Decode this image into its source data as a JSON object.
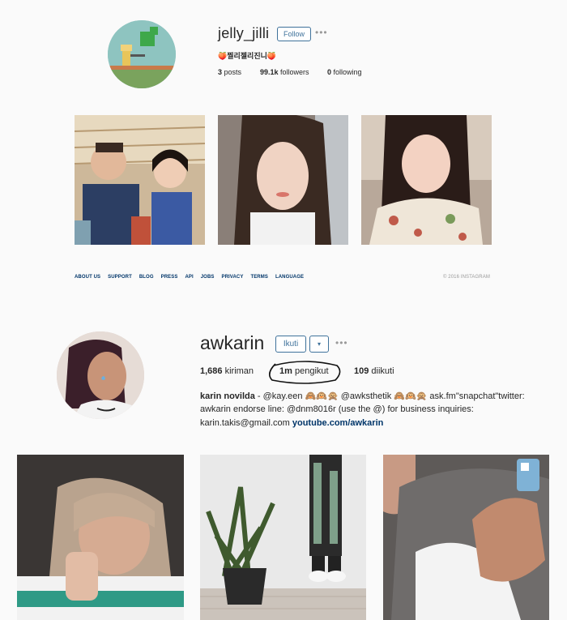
{
  "profile1": {
    "username": "jelly_jilli",
    "follow_label": "Follow",
    "more_label": "•••",
    "full_name": "🍑찔리젤리진니🍑",
    "stats": [
      {
        "value": "3",
        "label": "posts"
      },
      {
        "value": "99.1k",
        "label": "followers"
      },
      {
        "value": "0",
        "label": "following"
      }
    ],
    "footer_links": [
      "ABOUT US",
      "SUPPORT",
      "BLOG",
      "PRESS",
      "API",
      "JOBS",
      "PRIVACY",
      "TERMS",
      "LANGUAGE"
    ],
    "copyright": "© 2016 INSTAGRAM"
  },
  "profile2": {
    "username": "awkarin",
    "follow_label": "Ikuti",
    "dropdown_label": "▾",
    "more_label": "•••",
    "stats": [
      {
        "value": "1,686",
        "label": "kiriman"
      },
      {
        "value": "1m",
        "label": "pengikut"
      },
      {
        "value": "109",
        "label": "diikuti"
      }
    ],
    "bio_name": "karin novilda",
    "bio_line1_rest": " - @kay.een 🙈🙉🙊 @awksthetik 🙈🙉🙊 ask.fm\"snapchat\"twitter:",
    "bio_line2": "awkarin endorse line: @dnm8016r (use the @) for business inquiries:",
    "bio_line3_email": "karin.takis@gmail.com ",
    "bio_line3_link": "youtube.com/awkarin"
  },
  "colors": {
    "link_blue": "#3f729b",
    "footer_blue": "#003569",
    "annotation_circle": "#111111"
  }
}
